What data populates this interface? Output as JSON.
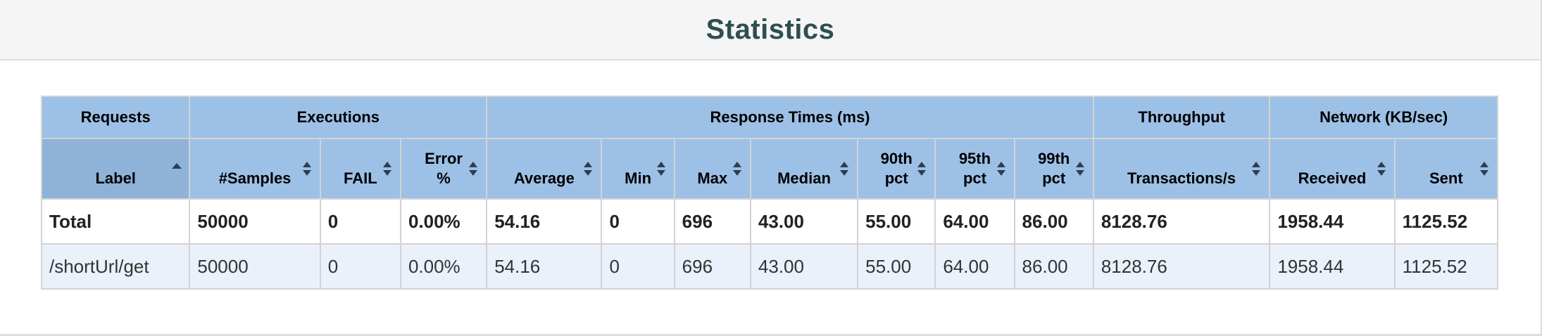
{
  "panel": {
    "title": "Statistics"
  },
  "table": {
    "groups": [
      "Requests",
      "Executions",
      "Response Times (ms)",
      "Throughput",
      "Network (KB/sec)"
    ],
    "columns": [
      {
        "line1": "Label",
        "line2": "",
        "sort": "ascending"
      },
      {
        "line1": "#Samples",
        "line2": "",
        "sort": "none"
      },
      {
        "line1": "FAIL",
        "line2": "",
        "sort": "none"
      },
      {
        "line1": "Error",
        "line2": "%",
        "sort": "none"
      },
      {
        "line1": "Average",
        "line2": "",
        "sort": "none"
      },
      {
        "line1": "Min",
        "line2": "",
        "sort": "none"
      },
      {
        "line1": "Max",
        "line2": "",
        "sort": "none"
      },
      {
        "line1": "Median",
        "line2": "",
        "sort": "none"
      },
      {
        "line1": "90th",
        "line2": "pct",
        "sort": "none"
      },
      {
        "line1": "95th",
        "line2": "pct",
        "sort": "none"
      },
      {
        "line1": "99th",
        "line2": "pct",
        "sort": "none"
      },
      {
        "line1": "Transactions/s",
        "line2": "",
        "sort": "none"
      },
      {
        "line1": "Received",
        "line2": "",
        "sort": "none"
      },
      {
        "line1": "Sent",
        "line2": "",
        "sort": "none"
      }
    ],
    "total": [
      "Total",
      "50000",
      "0",
      "0.00%",
      "54.16",
      "0",
      "696",
      "43.00",
      "55.00",
      "64.00",
      "86.00",
      "8128.76",
      "1958.44",
      "1125.52"
    ],
    "rows": [
      [
        "/shortUrl/get",
        "50000",
        "0",
        "0.00%",
        "54.16",
        "0",
        "696",
        "43.00",
        "55.00",
        "64.00",
        "86.00",
        "8128.76",
        "1958.44",
        "1125.52"
      ]
    ]
  },
  "icons": {
    "sort_both": "sort-both-icon",
    "sort_ascending": "sort-ascending-icon"
  },
  "colors": {
    "header_background": "#9dc0e6",
    "sorted_header_background": "#8fb2d8",
    "title_color": "#2f4f4f",
    "row_stripe": "#eaf1fb"
  }
}
